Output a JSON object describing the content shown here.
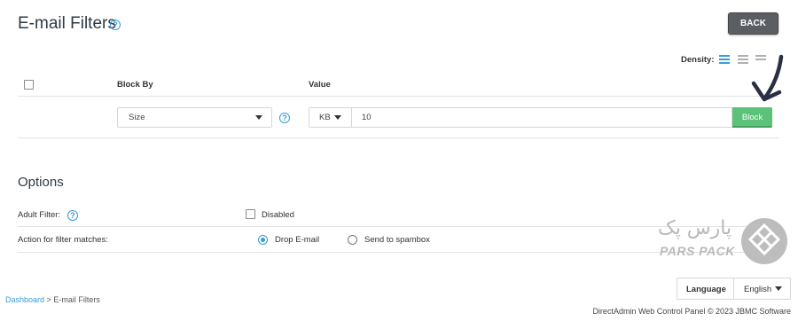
{
  "page": {
    "title": "E-mail Filters",
    "back_label": "BACK",
    "density_label": "Density:"
  },
  "filter_table": {
    "headers": {
      "block_by": "Block By",
      "value": "Value"
    },
    "block_by_selected": "Size",
    "unit_selected": "KB",
    "value": "10",
    "block_label": "Block"
  },
  "options": {
    "title": "Options",
    "adult_filter_label": "Adult Filter:",
    "adult_filter_option": "Disabled",
    "adult_filter_checked": false,
    "action_label": "Action for filter matches:",
    "actions": [
      {
        "label": "Drop E-mail",
        "selected": true
      },
      {
        "label": "Send to spambox",
        "selected": false
      }
    ]
  },
  "logo": {
    "persian_text": "پارس پک",
    "english_text": "PARS PACK"
  },
  "language": {
    "label": "Language",
    "selected": "English"
  },
  "breadcrumb": {
    "home": "Dashboard",
    "separator": ">",
    "current": "E-mail Filters"
  },
  "footer": {
    "text": "DirectAdmin Web Control Panel © 2023 JBMC Software"
  },
  "colors": {
    "accent": "#3c9ad6",
    "block_button": "#5cc27a",
    "back_button": "#5b5f63"
  }
}
